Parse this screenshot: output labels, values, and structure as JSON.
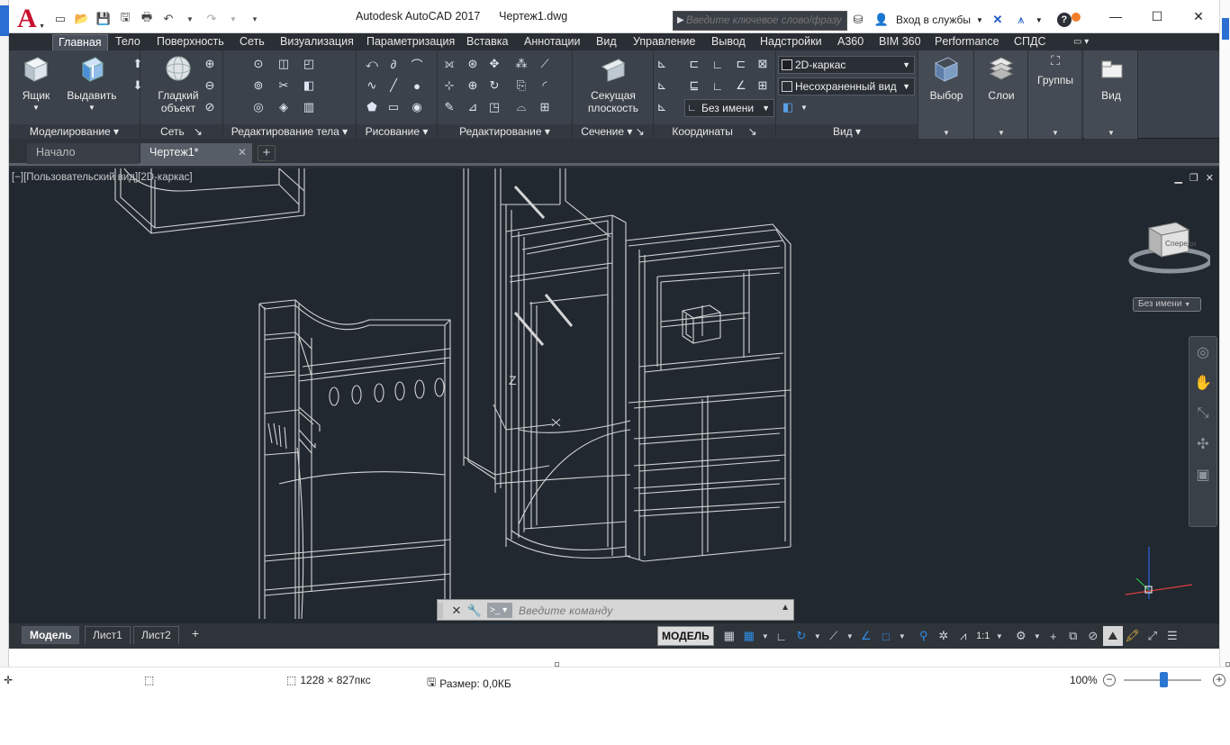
{
  "window": {
    "app_title": "Autodesk AutoCAD 2017",
    "doc_title": "Чертеж1.dwg",
    "search_placeholder": "Введите ключевое слово/фразу",
    "signin_label": "Вход в службы"
  },
  "ribbon_tabs": [
    "Главная",
    "Тело",
    "Поверхность",
    "Сеть",
    "Визуализация",
    "Параметризация",
    "Вставка",
    "Аннотации",
    "Вид",
    "Управление",
    "Вывод",
    "Надстройки",
    "A360",
    "BIM 360",
    "Performance",
    "СПДС"
  ],
  "ribbon": {
    "box_label": "Ящик",
    "extrude_label": "Выдавить",
    "smooth_label_1": "Гладкий",
    "smooth_label_2": "объект",
    "section_label_1": "Секущая",
    "section_label_2": "плоскость",
    "visual_style_value": "2D-каркас",
    "view_value": "Несохраненный вид",
    "ucs_value": "Без имени",
    "select_label": "Выбор",
    "layers_label": "Слои",
    "groups_label": "Группы",
    "view_label": "Вид",
    "panels": [
      "Моделирование",
      "Сеть",
      "Редактирование тела",
      "Рисование",
      "Редактирование",
      "Сечение",
      "Координаты",
      "Вид"
    ]
  },
  "file_tabs": {
    "start": "Начало",
    "doc": "Чертеж1*"
  },
  "viewport": {
    "label": "[−][Пользовательский вид][2D-каркас]",
    "viewcube_face": "Спереди",
    "unnamed": "Без имени",
    "z_axis": "Z"
  },
  "command": {
    "placeholder": "Введите команду"
  },
  "layout_tabs": [
    "Модель",
    "Лист1",
    "Лист2"
  ],
  "status": {
    "model_label": "МОДЕЛЬ",
    "scale": "1:1"
  },
  "viewer": {
    "dimensions": "1228 × 827пкс",
    "size": "Размер: 0,0КБ",
    "zoom": "100%"
  },
  "colors": {
    "accent_red": "#c8102e",
    "wire": "#d4d4d4",
    "canvas_bg": "#212830",
    "status_blue": "#2e8de6"
  }
}
